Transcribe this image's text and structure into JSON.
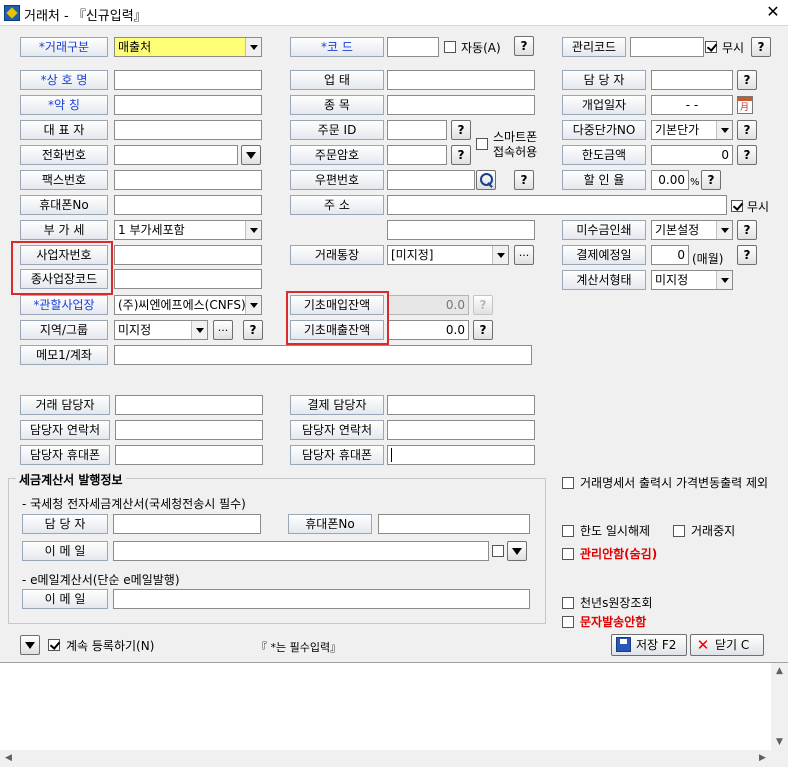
{
  "window": {
    "title": "거래처 - 『신규입력』",
    "close": "✕"
  },
  "row1": {
    "trade_type_label": "거래구분",
    "trade_type_value": "매출처",
    "code_label": "코 드",
    "auto_label": "자동(A)",
    "mgmt_code_label": "관리코드",
    "ignore_label": "무시"
  },
  "left": {
    "company_name": "상 호 명",
    "short_name": "약 칭",
    "ceo": "대 표 자",
    "phone": "전화번호",
    "fax": "팩스번호",
    "mobile": "휴대폰No",
    "vat": "부 가 세",
    "vat_value": "1 부가세포함",
    "biz_no": "사업자번호",
    "sub_biz_code": "종사업장코드",
    "branch": "관할사업장",
    "branch_value": "(주)씨엔에프에스(CNFS)",
    "region": "지역/그룹",
    "region_value": "미지정",
    "memo": "메모1/계좌"
  },
  "mid": {
    "business_type": "업 태",
    "business_item": "종 목",
    "order_id": "주문 ID",
    "order_pw": "주문암호",
    "smartphone_label": "스마트폰",
    "smartphone_label2": "접속허용",
    "zip": "우편번호",
    "address": "주 소",
    "address_ignore": "무시",
    "bank_account": "거래통장",
    "bank_account_value": "[미지정]",
    "base_purchase": "기초매입잔액",
    "base_purchase_value": "0.0",
    "base_sales": "기초매출잔액",
    "base_sales_value": "0.0"
  },
  "right": {
    "manager": "담 당 자",
    "open_date": "개업일자",
    "open_date_value": "  -  -",
    "cal_icon": "月",
    "multi_price": "다중단가NO",
    "multi_price_value": "기본단가",
    "limit_amount": "한도금액",
    "limit_amount_value": "0",
    "discount": "할 인 율",
    "discount_value": "0.00",
    "discount_unit": "%",
    "unpaid_print": "미수금인쇄",
    "unpaid_print_value": "기본설정",
    "pay_due": "결제예정일",
    "pay_due_value": "0",
    "pay_due_unit": "(매월)",
    "invoice_type": "계산서형태",
    "invoice_type_value": "미지정"
  },
  "contacts": {
    "trade_manager": "거래 담당자",
    "trade_contact": "담당자 연락처",
    "trade_mobile": "담당자 휴대폰",
    "pay_manager": "결제 담당자",
    "pay_contact": "담당자 연락처",
    "pay_mobile": "담당자 휴대폰"
  },
  "tax": {
    "group_title": "세금계산서 발행정보",
    "nts_title": "- 국세청 전자세금계산서(국세청전송시 필수)",
    "manager": "담 당 자",
    "mobile": "휴대폰No",
    "email": "이 메 일",
    "e_title": "- e메일계산서(단순 e메일발행)",
    "e_email": "이 메 일"
  },
  "options": {
    "exclude_price_change": "거래명세서 출력시 가격변동출력 제외",
    "limit_release": "한도 일시해제",
    "trade_stop": "거래중지",
    "mgmt_hide": "관리안함(숨김)",
    "ledger": "천년s원장조회",
    "no_sms": "문자발송안함"
  },
  "footer": {
    "continue_label": "계속 등록하기(N)",
    "required_note": "『 *는 필수입력』",
    "save_label": "저장 F2",
    "close_label": "닫기 C"
  },
  "icons": {
    "question": "?",
    "ellipsis": "..."
  }
}
